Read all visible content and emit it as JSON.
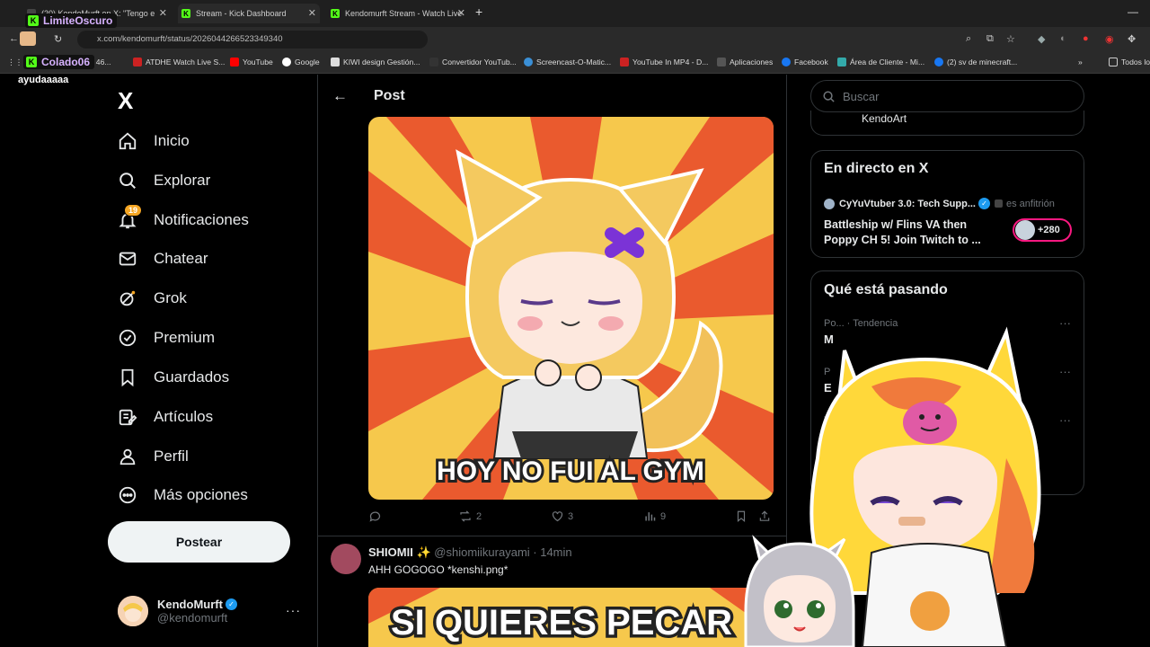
{
  "browser": {
    "tabs": [
      {
        "title": "(20) KendoMurft en X: \"Tengo e",
        "active": false
      },
      {
        "title": "Stream - Kick Dashboard",
        "active": true
      },
      {
        "title": "Kendomurft Stream - Watch Live",
        "active": false
      }
    ],
    "url": "x.com/kendomurft/status/2026044266523349340",
    "bookmarks": [
      "ard 46...",
      "ATDHE Watch Live S...",
      "YouTube",
      "Google",
      "KIWI design Gestión...",
      "Convertidor YouTub...",
      "Screencast-O-Matic...",
      "YouTube In MP4 - D...",
      "Aplicaciones",
      "Facebook",
      "Área de Cliente - Mi...",
      "(2) sv de minecraft...",
      "Todos los"
    ]
  },
  "overlay": {
    "chips": [
      "LimiteOscuro",
      "Colado06"
    ],
    "chat_text": "ayudaaaaa"
  },
  "sidebar": {
    "logo": "X",
    "items": [
      {
        "label": "Inicio",
        "icon": "home-icon"
      },
      {
        "label": "Explorar",
        "icon": "search-icon"
      },
      {
        "label": "Notificaciones",
        "icon": "bell-icon",
        "badge": "19"
      },
      {
        "label": "Chatear",
        "icon": "mail-icon"
      },
      {
        "label": "Grok",
        "icon": "grok-icon"
      },
      {
        "label": "Premium",
        "icon": "premium-icon"
      },
      {
        "label": "Guardados",
        "icon": "bookmark-icon"
      },
      {
        "label": "Artículos",
        "icon": "articles-icon"
      },
      {
        "label": "Perfil",
        "icon": "person-icon"
      },
      {
        "label": "Más opciones",
        "icon": "more-icon"
      }
    ],
    "post_button": "Postear",
    "profile": {
      "name": "KendoMurft",
      "handle": "@kendomurft"
    }
  },
  "main": {
    "title": "Post",
    "image_caption": "HOY NO FUI AL GYM",
    "actions": {
      "replies": "",
      "reposts": "2",
      "likes": "3",
      "views": "9"
    },
    "reply": {
      "name": "SHIOMII",
      "handle": "@shiomiikurayami · 14min",
      "text": "AHH GOGOGO *kenshi.png*",
      "image_caption": "SI QUIERES PECAR"
    }
  },
  "right": {
    "search_placeholder": "Buscar",
    "top_card_text": "KendoArt",
    "live": {
      "title": "En directo en X",
      "host_name": "CyYuVtuber 3.0: Tech Supp...",
      "host_role": "es anfitrión",
      "stream_title": "Battleship w/ Flins VA then Poppy CH 5! Join Twitch to ...",
      "count": "+280"
    },
    "trends": {
      "title": "Qué está pasando",
      "items": [
        {
          "meta": "Po... · Tendencia",
          "name": "M"
        },
        {
          "meta": "P",
          "name": "E"
        },
        {
          "meta": "Te",
          "name": ""
        }
      ]
    }
  },
  "colors": {
    "accent": "#1d9bf0",
    "kick": "#53fc18",
    "live_pink": "#f91880",
    "badge": "#f5a623"
  }
}
